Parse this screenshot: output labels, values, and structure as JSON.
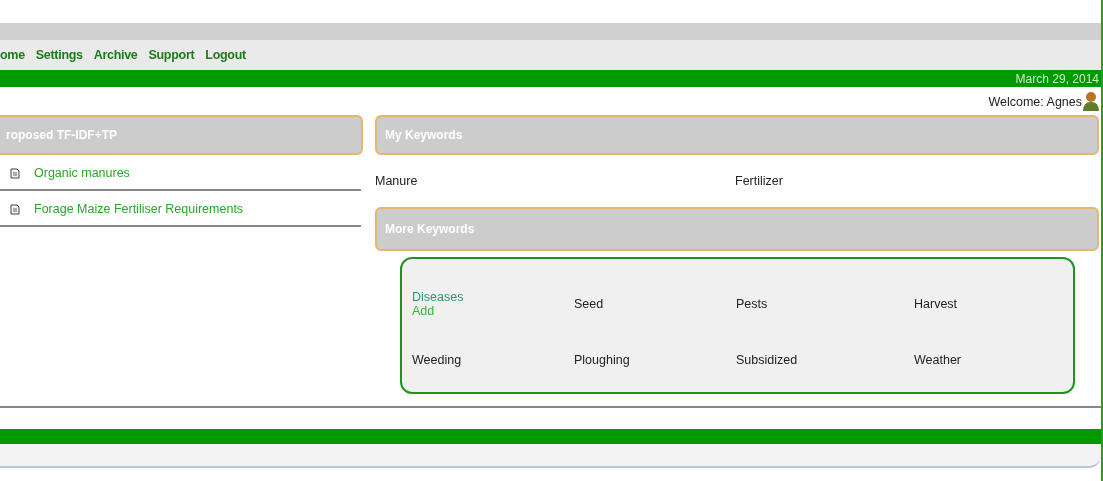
{
  "nav": [
    "ome",
    "Settings",
    "Archive",
    "Support",
    "Logout"
  ],
  "date": "March 29, 2014",
  "welcome": "Welcome: Agnes",
  "proposed": {
    "title": "roposed TF-IDF+TP",
    "items": [
      "Organic manures",
      "Forage Maize Fertiliser Requirements"
    ]
  },
  "my_keywords": {
    "title": "My Keywords",
    "items": [
      "Manure",
      "Fertilizer"
    ]
  },
  "more_keywords": {
    "title": "More Keywords",
    "items": [
      {
        "label": "Diseases",
        "kind": "link",
        "action": "Add"
      },
      {
        "label": "Seed",
        "kind": "plain"
      },
      {
        "label": "Pests",
        "kind": "plain"
      },
      {
        "label": "Harvest",
        "kind": "plain"
      },
      {
        "label": "Weeding",
        "kind": "plain"
      },
      {
        "label": "Ploughing",
        "kind": "plain"
      },
      {
        "label": "Subsidized",
        "kind": "plain"
      },
      {
        "label": "Weather",
        "kind": "plain"
      }
    ]
  }
}
